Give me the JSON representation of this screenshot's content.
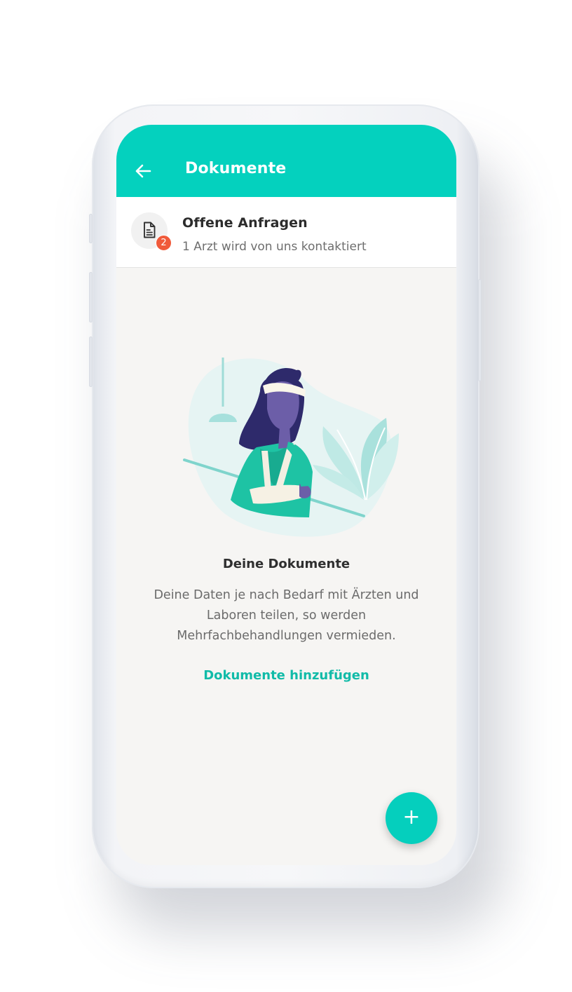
{
  "header": {
    "title": "Dokumente",
    "back_icon": "arrow-left-icon"
  },
  "requests": {
    "title": "Offene Anfragen",
    "subtitle": "1 Arzt wird von uns kontaktiert",
    "badge_count": "2",
    "icon": "document-icon"
  },
  "empty_state": {
    "title": "Deine Dokumente",
    "description": "Deine Daten je nach Bedarf mit Ärzten und Laboren teilen, so werden Mehrfachbehandlungen vermieden.",
    "action_label": "Dokumente hinzufügen"
  },
  "fab": {
    "label": "+"
  },
  "colors": {
    "accent": "#04d1be",
    "link": "#11bba8",
    "badge": "#f05a3a",
    "background": "#f6f5f3"
  }
}
